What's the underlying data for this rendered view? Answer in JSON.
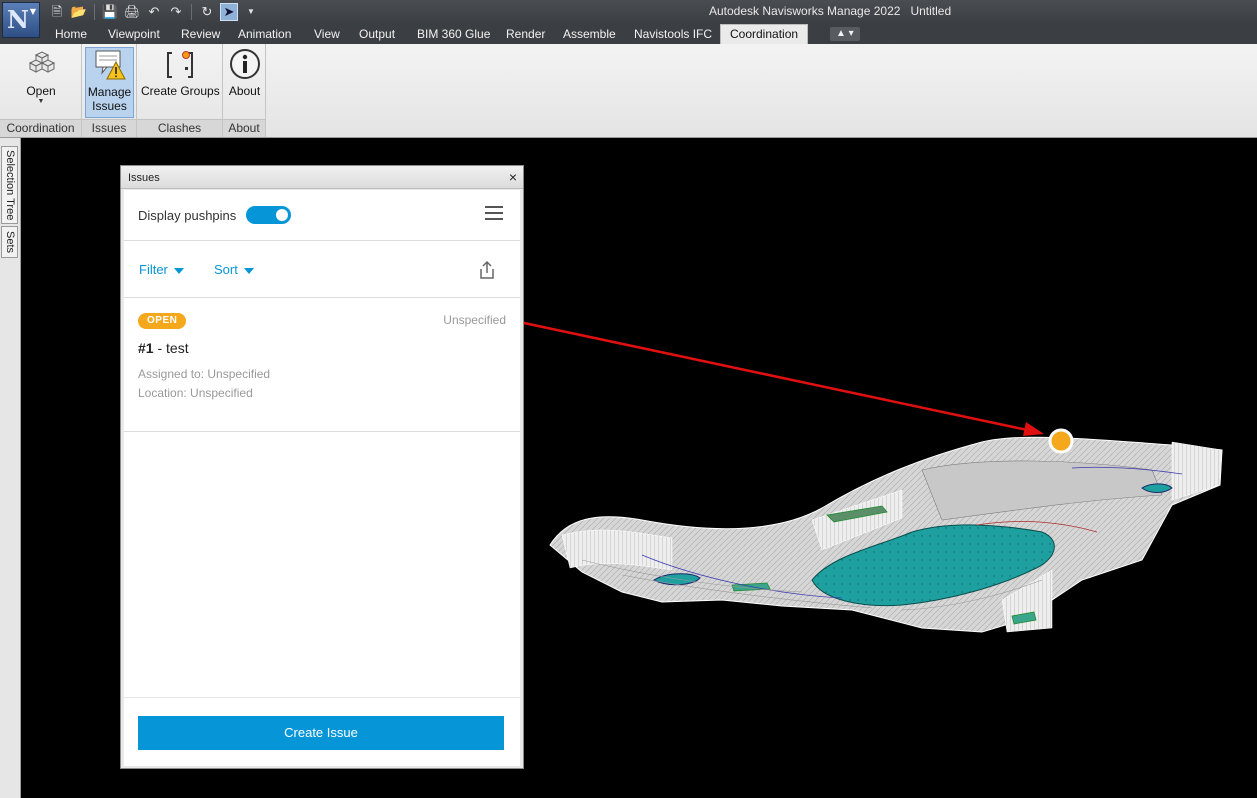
{
  "app": {
    "title": "Autodesk Navisworks Manage 2022",
    "document": "Untitled",
    "logo_letter": "N"
  },
  "quick_access": {
    "icons": [
      "new-file-icon",
      "open-folder-icon",
      "save-icon",
      "print-icon",
      "undo-icon",
      "redo-icon",
      "refresh-icon",
      "select-cursor-icon"
    ]
  },
  "menu": {
    "tabs": [
      "Home",
      "Viewpoint",
      "Review",
      "Animation",
      "View",
      "Output",
      "BIM 360 Glue",
      "Render",
      "Assemble",
      "Navistools IFC",
      "Coordination"
    ],
    "active": "Coordination"
  },
  "ribbon": {
    "panels": {
      "coordination": "Coordination",
      "issues": "Issues",
      "clashes": "Clashes",
      "about": "About"
    },
    "buttons": {
      "open": "Open",
      "manage_issues_1": "Manage",
      "manage_issues_2": "Issues",
      "create_groups": "Create Groups",
      "about": "About"
    }
  },
  "dock": {
    "tabs": [
      "Selection Tree",
      "Sets"
    ]
  },
  "issues_panel": {
    "title": "Issues",
    "close": "×",
    "display_pushpins": "Display pushpins",
    "pushpins_on": true,
    "filter": "Filter",
    "sort": "Sort",
    "issue": {
      "status": "OPEN",
      "type": "Unspecified",
      "number": "#1",
      "name": " - test",
      "assigned": "Assigned to: Unspecified",
      "location": "Location: Unspecified"
    },
    "create_button": "Create Issue"
  },
  "colors": {
    "accent": "#0696d7",
    "badge": "#f6a81c",
    "pushpin": "#f6a81c",
    "annotation_arrow": "#e01010",
    "water": "#1fa0a0"
  }
}
